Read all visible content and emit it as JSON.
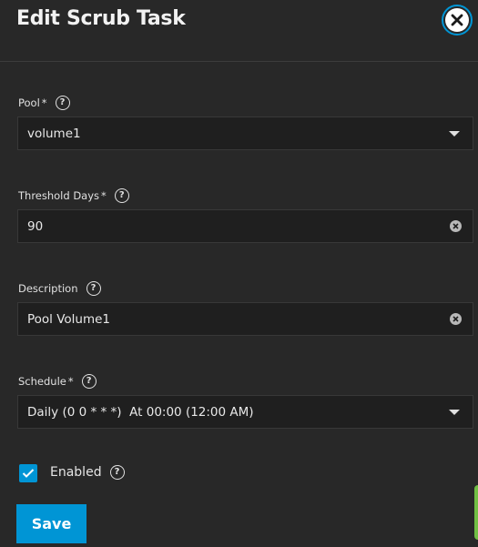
{
  "dialog": {
    "title": "Edit Scrub Task"
  },
  "form": {
    "pool": {
      "label": "Pool",
      "required_mark": "*",
      "value": "volume1"
    },
    "threshold_days": {
      "label": "Threshold Days",
      "required_mark": "*",
      "value": "90"
    },
    "description": {
      "label": "Description",
      "value": "Pool Volume1"
    },
    "schedule": {
      "label": "Schedule",
      "required_mark": "*",
      "value": "Daily (0 0 * * *)  At 00:00 (12:00 AM)"
    },
    "enabled": {
      "label": "Enabled",
      "checked": true
    },
    "help_glyph": "?"
  },
  "actions": {
    "save_label": "Save"
  },
  "colors": {
    "background": "#282828",
    "input_background": "#1f1f1f",
    "accent": "#0095d5",
    "side_tab": "#71bf44"
  },
  "icons": {
    "close": "close-icon",
    "help": "help-icon",
    "dropdown": "chevron-down-icon",
    "clear": "clear-icon",
    "check": "check-icon"
  }
}
